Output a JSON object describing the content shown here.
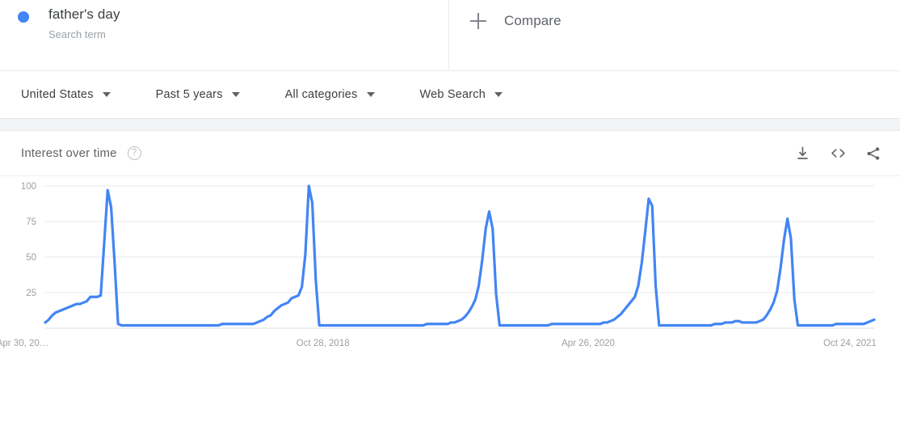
{
  "term": {
    "title": "father's day",
    "subtitle": "Search term",
    "dot_color": "#4285f4"
  },
  "compare": {
    "label": "Compare",
    "icon": "plus-icon"
  },
  "filters": [
    {
      "label": "United States",
      "name": "region"
    },
    {
      "label": "Past 5 years",
      "name": "time-range"
    },
    {
      "label": "All categories",
      "name": "category"
    },
    {
      "label": "Web Search",
      "name": "search-type"
    }
  ],
  "chart_header": {
    "title": "Interest over time",
    "help": "?",
    "actions": [
      {
        "name": "download-icon",
        "label": "download"
      },
      {
        "name": "embed-icon",
        "label": "embed"
      },
      {
        "name": "share-icon",
        "label": "share"
      }
    ]
  },
  "chart_data": {
    "type": "line",
    "title": "Interest over time",
    "xlabel": "",
    "ylabel": "",
    "ylim": [
      0,
      100
    ],
    "grid": true,
    "legend_position": "top-left",
    "line_color": "#4285f4",
    "series": [
      {
        "name": "father's day",
        "values": [
          4,
          6,
          9,
          11,
          12,
          13,
          14,
          15,
          16,
          17,
          17,
          18,
          19,
          22,
          22,
          22,
          23,
          60,
          97,
          85,
          46,
          3,
          2,
          2,
          2,
          2,
          2,
          2,
          2,
          2,
          2,
          2,
          2,
          2,
          2,
          2,
          2,
          2,
          2,
          2,
          2,
          2,
          2,
          2,
          2,
          2,
          2,
          2,
          2,
          2,
          2,
          3,
          3,
          3,
          3,
          3,
          3,
          3,
          3,
          3,
          3,
          4,
          5,
          6,
          8,
          9,
          12,
          14,
          16,
          17,
          18,
          21,
          22,
          23,
          29,
          52,
          100,
          88,
          34,
          2,
          2,
          2,
          2,
          2,
          2,
          2,
          2,
          2,
          2,
          2,
          2,
          2,
          2,
          2,
          2,
          2,
          2,
          2,
          2,
          2,
          2,
          2,
          2,
          2,
          2,
          2,
          2,
          2,
          2,
          2,
          3,
          3,
          3,
          3,
          3,
          3,
          3,
          4,
          4,
          5,
          6,
          8,
          11,
          15,
          20,
          30,
          48,
          70,
          82,
          70,
          24,
          2,
          2,
          2,
          2,
          2,
          2,
          2,
          2,
          2,
          2,
          2,
          2,
          2,
          2,
          2,
          3,
          3,
          3,
          3,
          3,
          3,
          3,
          3,
          3,
          3,
          3,
          3,
          3,
          3,
          3,
          4,
          4,
          5,
          6,
          8,
          10,
          13,
          16,
          19,
          22,
          30,
          46,
          68,
          91,
          86,
          30,
          2,
          2,
          2,
          2,
          2,
          2,
          2,
          2,
          2,
          2,
          2,
          2,
          2,
          2,
          2,
          2,
          3,
          3,
          3,
          4,
          4,
          4,
          5,
          5,
          4,
          4,
          4,
          4,
          4,
          5,
          6,
          9,
          13,
          18,
          26,
          42,
          62,
          77,
          63,
          20,
          2,
          2,
          2,
          2,
          2,
          2,
          2,
          2,
          2,
          2,
          2,
          3,
          3,
          3,
          3,
          3,
          3,
          3,
          3,
          3,
          4,
          5,
          6
        ]
      }
    ],
    "ytick_labels": [
      "100",
      "75",
      "50",
      "25"
    ],
    "ytick_values": [
      100,
      75,
      50,
      25
    ],
    "xtick_labels": [
      "Apr 30, 20…",
      "Oct 28, 2018",
      "Apr 26, 2020",
      "Oct 24, 2021"
    ],
    "xtick_positions": [
      0.01,
      0.335,
      0.655,
      0.975
    ]
  }
}
